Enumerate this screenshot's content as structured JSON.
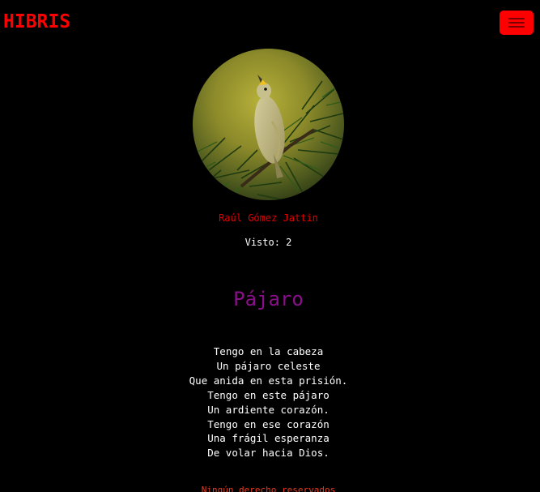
{
  "navbar": {
    "brand": "HIBRIS",
    "toggler_icon": "hamburger-menu-icon",
    "brand_color": "#ff0000",
    "toggler_color": "#ff0000"
  },
  "post": {
    "image_alt": "bird-photo",
    "author": "Raúl Gómez Jattin",
    "views": "Visto: 2",
    "title": "Pájaro",
    "lines": [
      "Tengo en la cabeza",
      "Un pájaro celeste",
      "Que anida en esta prisión.",
      "Tengo en este pájaro",
      "Un ardiente corazón.",
      "Tengo en ese corazón",
      "Una frágil esperanza",
      "De volar hacia Dios."
    ],
    "author_color": "#e00000",
    "title_color": "#8a0f8a"
  },
  "footer": {
    "text": "Ningún derecho reservados",
    "color": "#e63b1e"
  }
}
